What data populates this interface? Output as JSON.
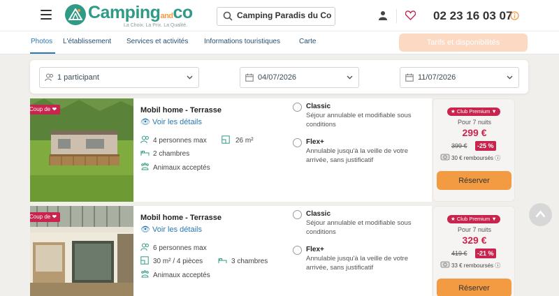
{
  "header": {
    "logo_main": "Camping",
    "logo_and": "and",
    "logo_co": "co",
    "logo_tagline": "La Choix. La Prix. La Qualité.",
    "search_value": "Camping Paradis du Co",
    "phone": "02 23 16 03 07",
    "brand_color": "#2f9a86",
    "accent_color": "#f39b43"
  },
  "nav": {
    "tabs": [
      {
        "label": "Photos",
        "active": true
      },
      {
        "label": "L'établissement",
        "active": false
      },
      {
        "label": "Services et activités",
        "active": false
      },
      {
        "label": "Informations touristiques",
        "active": false
      },
      {
        "label": "Carte",
        "active": false
      }
    ],
    "tarifs_label": "Tarifs et disponibilités"
  },
  "filters": {
    "participants": "1 participant",
    "date_start": "04/07/2026",
    "date_end": "11/07/2026"
  },
  "listings": [
    {
      "badge": "Coup de",
      "title": "Mobil home - Terrasse",
      "details_link": "Voir les détails",
      "persons": "4 personnes max",
      "area": "26 m²",
      "rooms": "2 chambres",
      "pets": "Animaux acceptés",
      "options": [
        {
          "name": "Classic",
          "desc": "Séjour annulable et modifiable sous conditions"
        },
        {
          "name": "Flex+",
          "desc": "Annulable jusqu'à la veille de votre arrivée, sans justificatif"
        }
      ],
      "premium_label": "Club Premium",
      "nights": "Pour 7 nuits",
      "price": "299 €",
      "old_price": "399 €",
      "discount": "-25 %",
      "refund": "30 € remboursés",
      "reserve_label": "Réserver"
    },
    {
      "badge": "Coup de",
      "title": "Mobil home - Terrasse",
      "details_link": "Voir les détails",
      "persons": "6 personnes max",
      "area": "30 m² / 4 pièces",
      "rooms": "3 chambres",
      "pets": "Animaux acceptés",
      "options": [
        {
          "name": "Classic",
          "desc": "Séjour annulable et modifiable sous conditions"
        },
        {
          "name": "Flex+",
          "desc": "Annulable jusqu'à la veille de votre arrivée, sans justificatif"
        }
      ],
      "premium_label": "Club Premium",
      "nights": "Pour 7 nuits",
      "price": "329 €",
      "old_price": "419 €",
      "discount": "-21 %",
      "refund": "33 € remboursés",
      "reserve_label": "Réserver"
    }
  ]
}
